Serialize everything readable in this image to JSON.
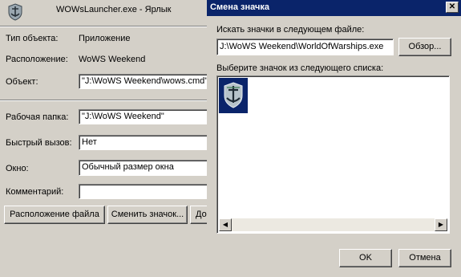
{
  "properties": {
    "title": "WOWsLauncher.exe - Ярлык",
    "icon": "warships-app-icon",
    "rows": {
      "type_label": "Тип объекта:",
      "type_value": "Приложение",
      "location_label": "Расположение:",
      "location_value": "WoWS Weekend",
      "target_label": "Объект:",
      "target_value": "\"J:\\WoWS Weekend\\wows.cmd\"",
      "workdir_label": "Рабочая папка:",
      "workdir_value": "\"J:\\WoWS Weekend\"",
      "hotkey_label": "Быстрый вызов:",
      "hotkey_value": "Нет",
      "window_label": "Окно:",
      "window_value": "Обычный размер окна",
      "comment_label": "Комментарий:",
      "comment_value": ""
    },
    "buttons": {
      "file_location": "Расположение файла",
      "change_icon": "Сменить значок...",
      "advanced": "Дополнительно..."
    }
  },
  "change_icon_dialog": {
    "title": "Смена значка",
    "close_icon": "close-icon",
    "search_label": "Искать значки в следующем файле:",
    "file_path": "J:\\WoWS Weekend\\WorldOfWarships.exe",
    "browse_label": "Обзор...",
    "list_label": "Выберите значок из следующего списка:",
    "icons": [
      "warships-icon"
    ],
    "ok_label": "OK",
    "cancel_label": "Отмена"
  },
  "colors": {
    "face": "#d4d0c8",
    "titlebar": "#0a246a",
    "selection": "#0a246a"
  }
}
